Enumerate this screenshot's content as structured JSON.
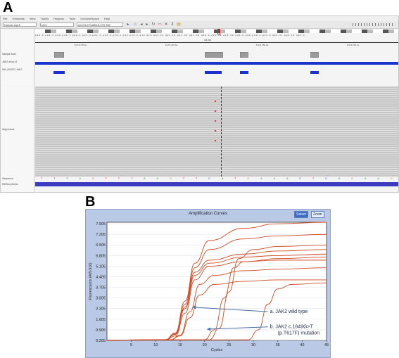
{
  "panel_a": {
    "label": "A",
    "menu": [
      "File",
      "Genomes",
      "View",
      "Tracks",
      "Regions",
      "Tools",
      "GenomeSpace",
      "Help"
    ],
    "genome": "Human hg19",
    "chromosome": "chr9",
    "locus": "chr9:5,073,685-5,073,780",
    "scale_label": "41 bp",
    "ruler_ticks": [
      "5,073,730 bp",
      "5,073,740 bp",
      "5,073,750 bp",
      "5,073,760 bp"
    ],
    "track_labels": {
      "track1": "Sample.bam",
      "track2": "JAK2-exon14",
      "track3": "NM_004972 JAK2",
      "alignments": "Alignments",
      "sequence": "Sequence",
      "refseq": "RefSeq Genes"
    },
    "sequence": [
      "T",
      "T",
      "T",
      "A",
      "G",
      "T",
      "T",
      "T",
      "A",
      "A",
      "G",
      "T",
      "T",
      "C",
      "A",
      "T",
      "G",
      "A",
      "A",
      "A",
      "C",
      "T",
      "C",
      "A",
      "G",
      "A",
      "A",
      "G"
    ]
  },
  "panel_b": {
    "label": "B",
    "title": "Amplification Curves",
    "buttons": {
      "select": "Select",
      "zoom": "Zoom"
    },
    "annotations": {
      "a": "a. JAK2 wild type",
      "b1": "b. JAK2 c.1849G>T",
      "b2": "(p.T617F) mutation"
    },
    "ylabel": "Fluorescence (465-510)",
    "xlabel": "Cycles"
  },
  "chart_data": {
    "type": "line",
    "title": "Amplification Curves",
    "xlabel": "Cycles",
    "ylabel": "Fluorescence (465-510)",
    "xlim": [
      0,
      45
    ],
    "ylim": [
      0.205,
      8.0
    ],
    "x_ticks": [
      5,
      10,
      15,
      20,
      25,
      30,
      35,
      40,
      45
    ],
    "y_ticks": [
      "0.205",
      "0.905",
      "1.605",
      "2.305",
      "3.005",
      "3.705",
      "4.405",
      "5.105",
      "5.805",
      "6.505",
      "7.205",
      "7.905"
    ],
    "series_color": "#d04a22",
    "series": [
      {
        "values": [
          [
            0,
            0.22
          ],
          [
            12,
            0.25
          ],
          [
            14,
            0.6
          ],
          [
            16,
            2.4
          ],
          [
            18,
            4.7
          ],
          [
            21,
            5.5
          ],
          [
            28,
            5.9
          ],
          [
            35,
            6.1
          ],
          [
            45,
            6.2
          ]
        ]
      },
      {
        "values": [
          [
            0,
            0.22
          ],
          [
            12,
            0.24
          ],
          [
            14,
            0.5
          ],
          [
            16,
            2.0
          ],
          [
            18,
            4.2
          ],
          [
            21,
            5.1
          ],
          [
            28,
            5.4
          ],
          [
            35,
            5.6
          ],
          [
            45,
            5.7
          ]
        ]
      },
      {
        "values": [
          [
            0,
            0.22
          ],
          [
            12,
            0.25
          ],
          [
            14,
            0.65
          ],
          [
            16,
            2.6
          ],
          [
            18,
            5.0
          ],
          [
            21,
            6.2
          ],
          [
            28,
            6.9
          ],
          [
            35,
            7.1
          ],
          [
            45,
            7.2
          ]
        ]
      },
      {
        "values": [
          [
            0,
            0.22
          ],
          [
            12,
            0.26
          ],
          [
            14,
            0.7
          ],
          [
            16,
            2.8
          ],
          [
            18,
            5.3
          ],
          [
            21,
            6.8
          ],
          [
            28,
            7.6
          ],
          [
            35,
            7.9
          ],
          [
            45,
            8.0
          ]
        ]
      },
      {
        "values": [
          [
            0,
            0.22
          ],
          [
            13,
            0.25
          ],
          [
            15,
            0.55
          ],
          [
            17,
            2.1
          ],
          [
            19,
            3.9
          ],
          [
            22,
            4.5
          ],
          [
            28,
            4.8
          ],
          [
            35,
            4.9
          ],
          [
            45,
            5.0
          ]
        ]
      },
      {
        "values": [
          [
            0,
            0.22
          ],
          [
            13,
            0.24
          ],
          [
            15,
            0.5
          ],
          [
            17,
            1.7
          ],
          [
            19,
            3.2
          ],
          [
            22,
            3.9
          ],
          [
            28,
            4.1
          ],
          [
            35,
            4.2
          ],
          [
            45,
            4.2
          ]
        ]
      },
      {
        "values": [
          [
            0,
            0.22
          ],
          [
            12,
            0.25
          ],
          [
            14,
            0.6
          ],
          [
            16,
            2.3
          ],
          [
            18,
            4.5
          ],
          [
            21,
            5.3
          ],
          [
            28,
            5.7
          ],
          [
            35,
            5.8
          ],
          [
            45,
            5.9
          ]
        ]
      },
      {
        "values": [
          [
            0,
            0.22
          ],
          [
            20,
            0.25
          ],
          [
            22,
            0.9
          ],
          [
            24,
            3.0
          ],
          [
            26,
            5.0
          ],
          [
            28,
            5.4
          ],
          [
            35,
            5.5
          ],
          [
            45,
            5.5
          ]
        ]
      },
      {
        "values": [
          [
            0,
            0.22
          ],
          [
            21,
            0.25
          ],
          [
            23,
            1.0
          ],
          [
            25,
            3.4
          ],
          [
            27,
            5.6
          ],
          [
            30,
            6.2
          ],
          [
            35,
            6.4
          ],
          [
            45,
            6.5
          ]
        ]
      },
      {
        "values": [
          [
            0,
            0.22
          ],
          [
            29,
            0.25
          ],
          [
            31,
            0.9
          ],
          [
            33,
            2.6
          ],
          [
            35,
            3.6
          ],
          [
            38,
            3.9
          ],
          [
            45,
            4.0
          ]
        ]
      }
    ]
  }
}
